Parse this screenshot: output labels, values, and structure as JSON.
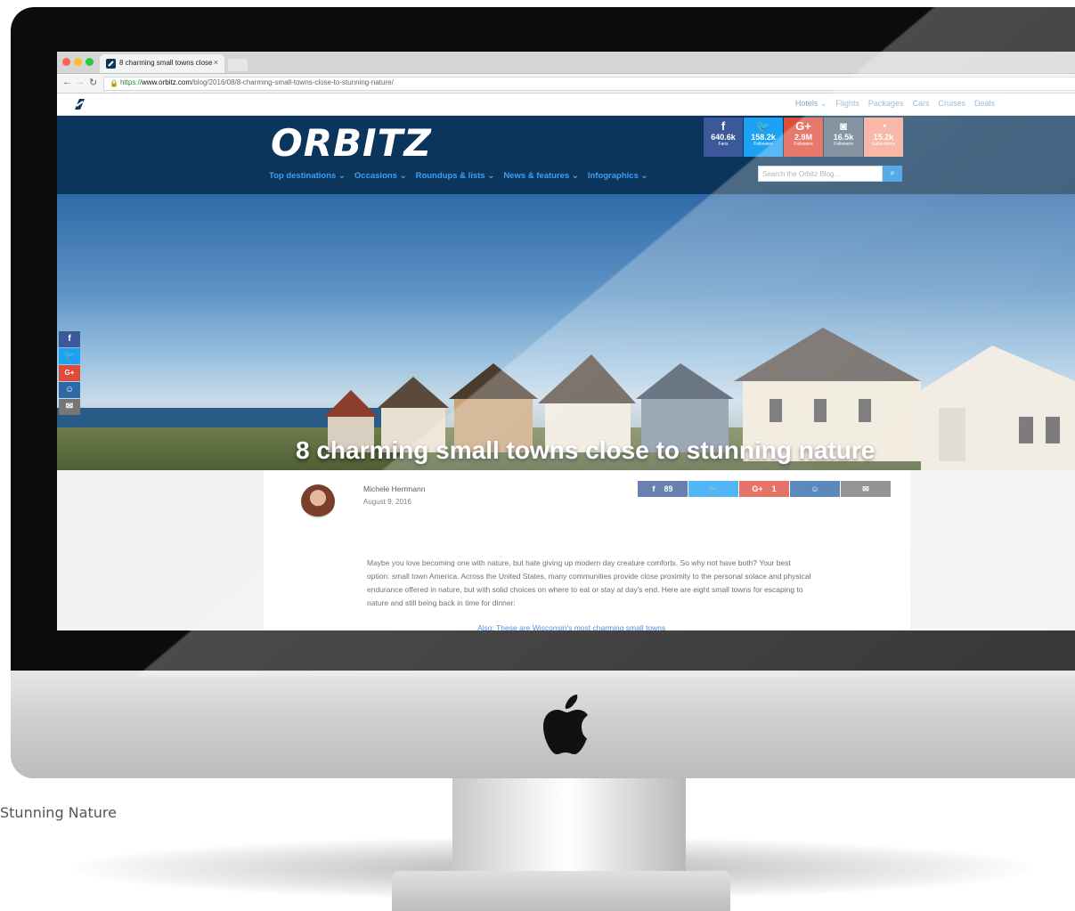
{
  "caption": "Stunning Nature",
  "browser": {
    "tab_title": "8 charming small towns close",
    "tab_close": "×",
    "url_protocol": "https://",
    "url_host": "www.orbitz.com",
    "url_path": "/blog/2016/08/8-charming-small-towns-close-to-stunning-nature/"
  },
  "topnav": {
    "links": [
      "Hotels",
      "Flights",
      "Packages",
      "Cars",
      "Cruises",
      "Deals"
    ]
  },
  "header": {
    "brand": "ORBITZ",
    "main_nav": [
      "Top destinations",
      "Occasions",
      "Roundups & lists",
      "News & features",
      "Infographics"
    ],
    "search_placeholder": "Search the Orbitz Blog...",
    "social": [
      {
        "icon": "f",
        "count": "640.6k",
        "label": "Fans"
      },
      {
        "icon": "twitter-icon",
        "count": "158.2k",
        "label": "Followers"
      },
      {
        "icon": "G+",
        "count": "2.9M",
        "label": "Followers"
      },
      {
        "icon": "instagram-icon",
        "count": "16.5k",
        "label": "Followers"
      },
      {
        "icon": "rss-icon",
        "count": "15.2k",
        "label": "Subscribers"
      }
    ]
  },
  "hero": {
    "title": "8 charming small towns close to stunning nature"
  },
  "article": {
    "author": "Michele Herrmann",
    "date": "August 9, 2016",
    "share": {
      "facebook_count": "89",
      "gplus_count": "1"
    },
    "body": "Maybe you love becoming one with nature, but hate giving up modern day creature comforts. So why not have both? Your best option: small town America. Across the United States, many communities provide close proximity to the personal solace and physical endurance offered in nature, but with solid choices on where to eat or stay at day's end. Here are eight small towns for escaping to nature and still being back in time for dinner:",
    "also_link": "Also: These are Wisconsin's most charming small towns"
  },
  "colors": {
    "header_bg": "#0c355b",
    "nav_link": "#3aa0f5",
    "facebook": "#3b5998",
    "twitter": "#1da1f2",
    "gplus": "#dd4b39"
  }
}
